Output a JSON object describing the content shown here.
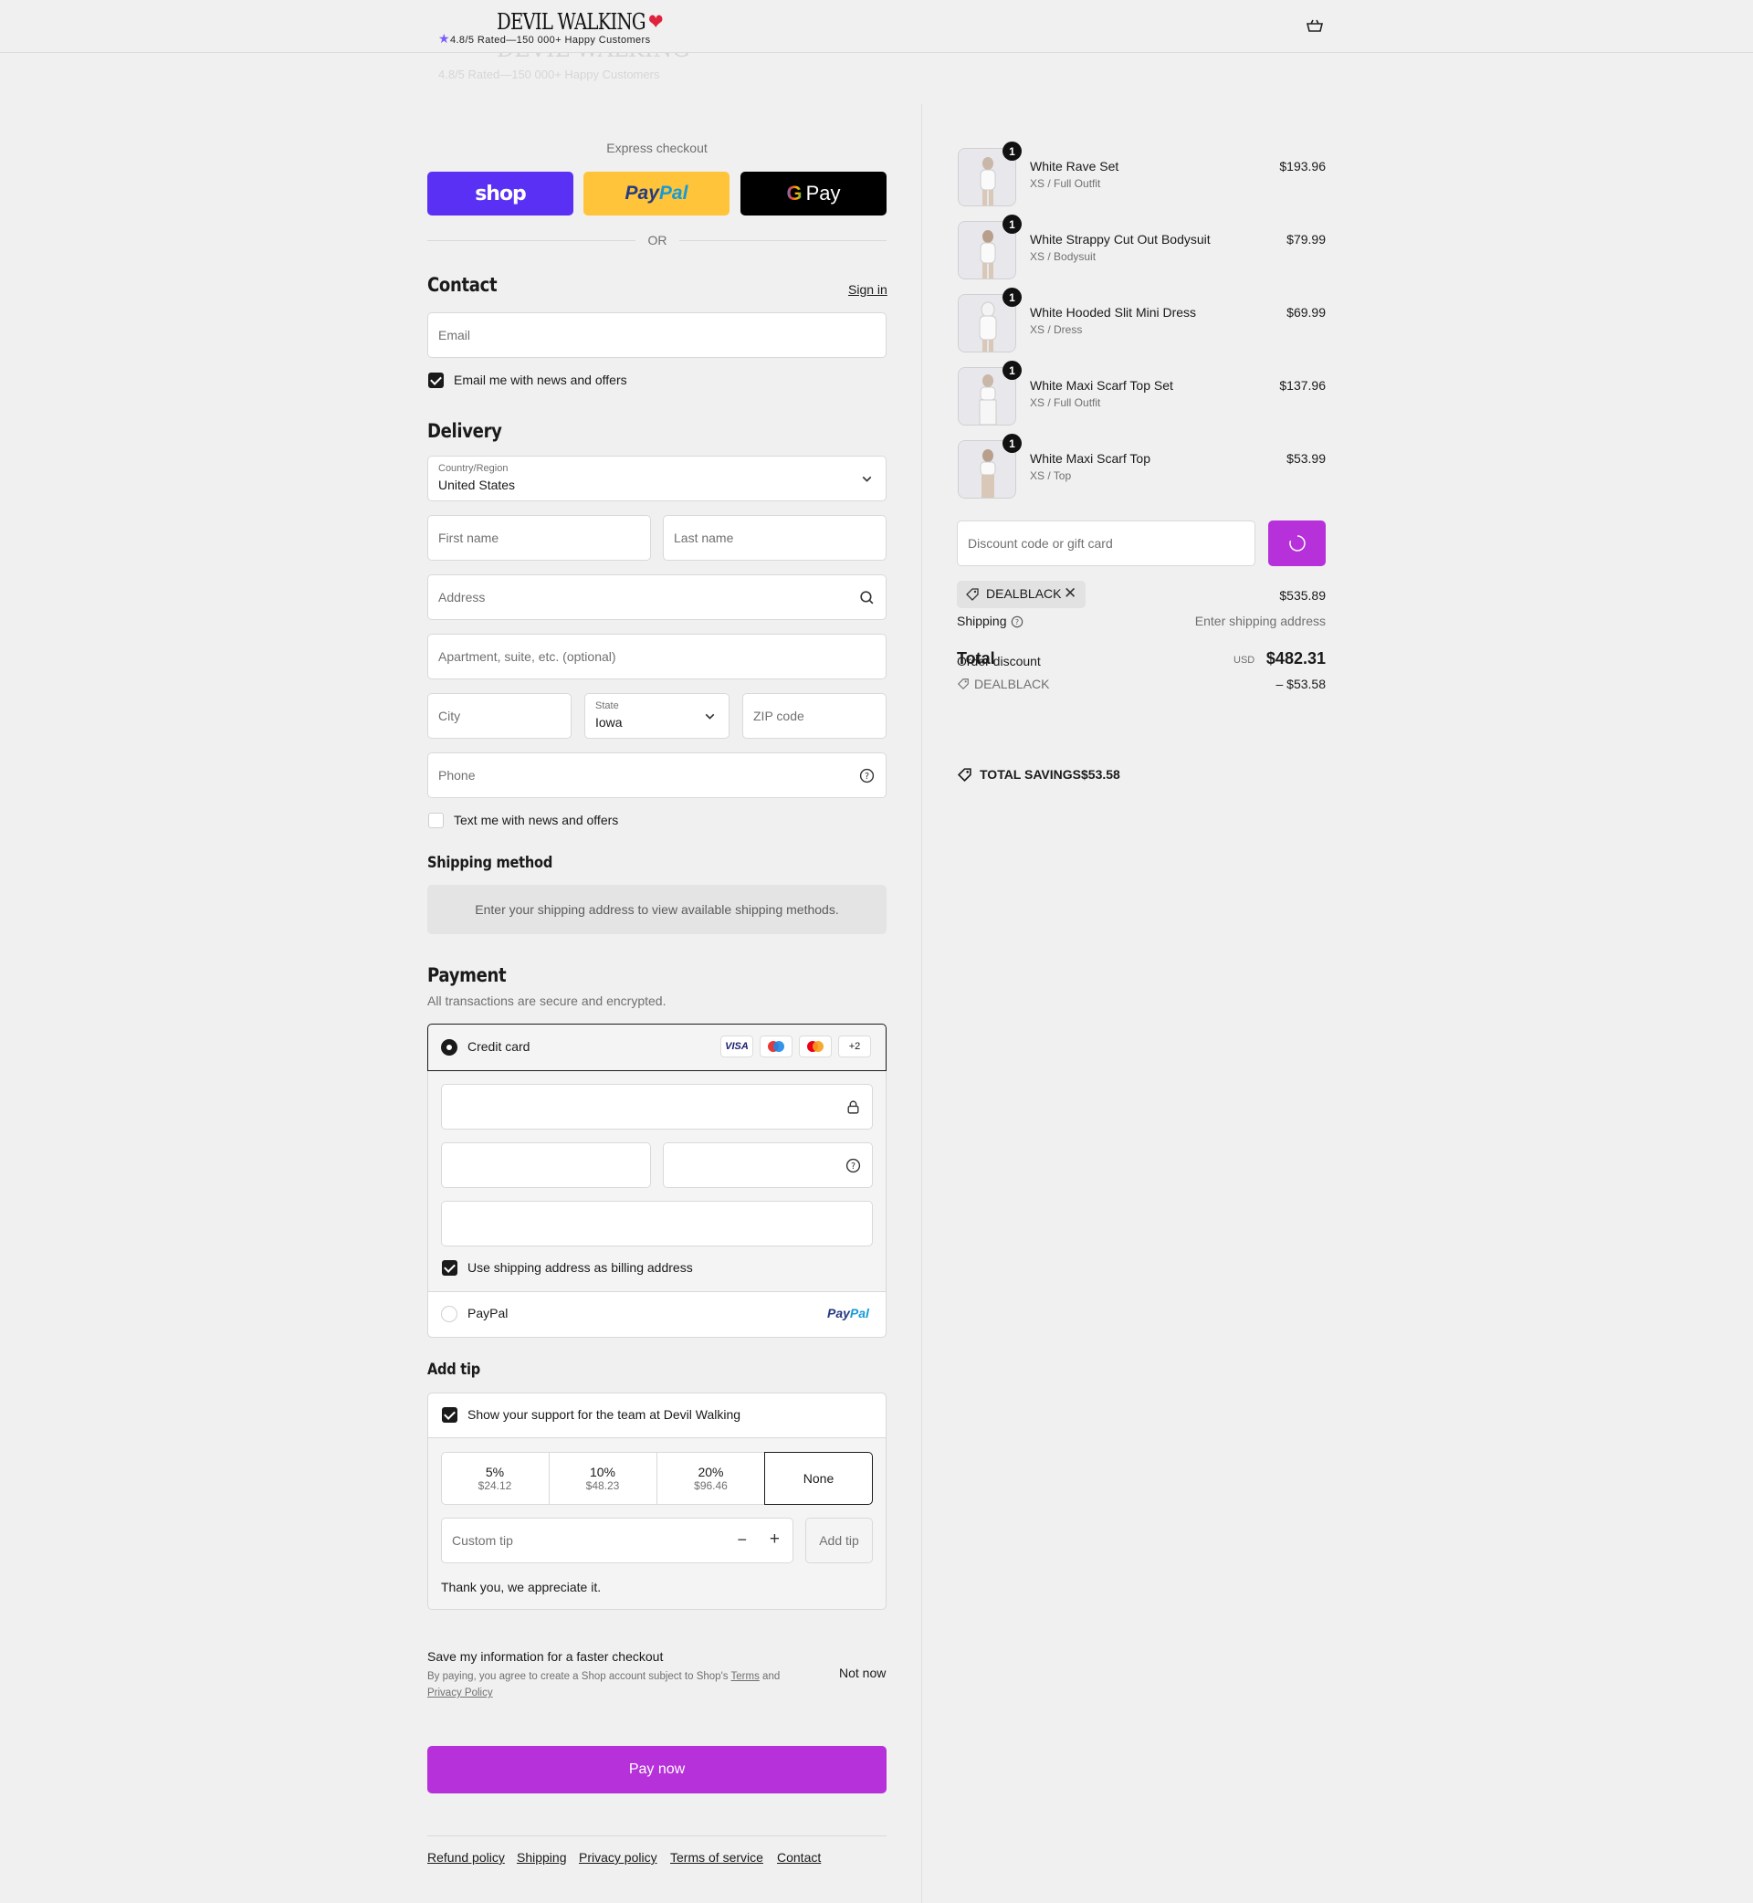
{
  "header": {
    "logo_text": "DEVIL WALKING",
    "rating_text": "4.8/5 Rated—150 000+ Happy Customers"
  },
  "express": {
    "title": "Express checkout",
    "shop_label": "shop",
    "paypal_pay": "Pay",
    "paypal_pal": "Pal",
    "gpay_label": "Pay",
    "or_label": "OR"
  },
  "contact": {
    "title": "Contact",
    "sign_in": "Sign in",
    "email_placeholder": "Email",
    "news_label": "Email me with news and offers"
  },
  "delivery": {
    "title": "Delivery",
    "country_label": "Country/Region",
    "country_value": "United States",
    "first_name": "First name",
    "last_name": "Last name",
    "address": "Address",
    "apartment": "Apartment, suite, etc. (optional)",
    "city": "City",
    "state_label": "State",
    "state_value": "Iowa",
    "zip": "ZIP code",
    "phone": "Phone",
    "text_label": "Text me with news and offers"
  },
  "shipping_method": {
    "title": "Shipping method",
    "notice": "Enter your shipping address to view available shipping methods."
  },
  "payment": {
    "title": "Payment",
    "subtitle": "All transactions are secure and encrypted.",
    "credit_card": "Credit card",
    "visa": "VISA",
    "more_cards": "+2",
    "billing_label": "Use shipping address as billing address",
    "paypal": "PayPal",
    "paypal_logo_pay": "Pay",
    "paypal_logo_pal": "Pal"
  },
  "tip": {
    "title": "Add tip",
    "support_label": "Show your support for the team at Devil Walking",
    "options": [
      {
        "pct": "5%",
        "amount": "$24.12"
      },
      {
        "pct": "10%",
        "amount": "$48.23"
      },
      {
        "pct": "20%",
        "amount": "$96.46"
      },
      {
        "pct": "None",
        "amount": ""
      }
    ],
    "custom_placeholder": "Custom tip",
    "add_button": "Add tip",
    "thanks": "Thank you, we appreciate it."
  },
  "save_info": {
    "title": "Save my information for a faster checkout",
    "terms_prefix": "By paying, you agree to create a Shop account subject to Shop's",
    "terms_link": "Terms",
    "and": "and",
    "privacy_link": "Privacy Policy",
    "not_now": "Not now"
  },
  "pay_button": "Pay now",
  "footer": {
    "links": [
      "Refund policy",
      "Shipping",
      "Privacy policy",
      "Terms of service",
      "Contact"
    ]
  },
  "order": {
    "items": [
      {
        "qty": "1",
        "name": "White Rave Set",
        "variant": "XS / Full Outfit",
        "price": "$193.96"
      },
      {
        "qty": "1",
        "name": "White Strappy Cut Out Bodysuit",
        "variant": "XS / Bodysuit",
        "price": "$79.99"
      },
      {
        "qty": "1",
        "name": "White Hooded Slit Mini Dress",
        "variant": "XS / Dress",
        "price": "$69.99"
      },
      {
        "qty": "1",
        "name": "White Maxi Scarf Top Set",
        "variant": "XS / Full Outfit",
        "price": "$137.96"
      },
      {
        "qty": "1",
        "name": "White Maxi Scarf Top",
        "variant": "XS / Top",
        "price": "$53.99"
      }
    ],
    "discount_placeholder": "Discount code or gift card",
    "discount_tag": "DEALBLACK",
    "subtotal_value": "$535.89",
    "shipping_label": "Shipping",
    "shipping_value": "Enter shipping address",
    "total_label": "Total",
    "order_discount_label": "Order discount",
    "currency": "USD",
    "total_value": "$482.31",
    "discount_code": "DEALBLACK",
    "discount_value": "– $53.58",
    "savings_label": "TOTAL SAVINGS",
    "savings_value": "$53.58"
  },
  "colors": {
    "accent": "#b631d9",
    "shop_pay": "#5a31f4",
    "paypal_yellow": "#ffc439"
  }
}
